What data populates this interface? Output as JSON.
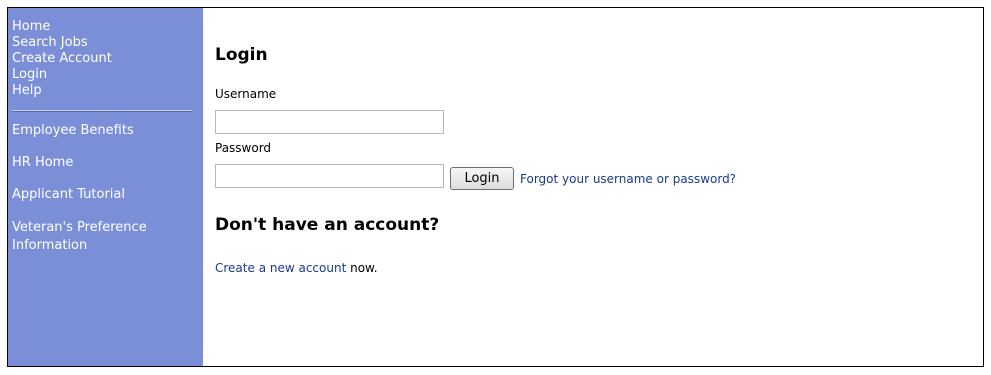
{
  "sidebar": {
    "top_links": [
      {
        "label": "Home"
      },
      {
        "label": "Search Jobs"
      },
      {
        "label": "Create Account"
      },
      {
        "label": "Login"
      },
      {
        "label": "Help"
      }
    ],
    "bottom_links": [
      {
        "label": "Employee Benefits"
      },
      {
        "label": "HR Home"
      },
      {
        "label": "Applicant Tutorial"
      },
      {
        "label": "Veteran's Preference Information"
      }
    ]
  },
  "login": {
    "title": "Login",
    "username_label": "Username",
    "username_value": "",
    "password_label": "Password",
    "password_value": "",
    "button_label": "Login",
    "forgot_link": "Forgot your username or password?"
  },
  "signup": {
    "title": "Don't have an account?",
    "link_text": "Create a new account",
    "suffix": " now."
  },
  "colors": {
    "sidebar_bg": "#7b8fd8",
    "link": "#1a3a8c"
  }
}
